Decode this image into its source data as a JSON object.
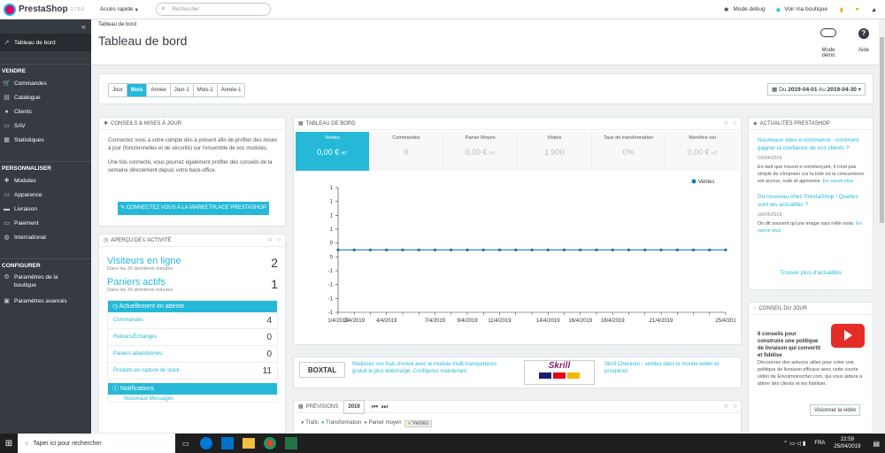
{
  "logo": {
    "name": "PrestaShop",
    "version": "1.7.5.0"
  },
  "topbar": {
    "quick_access": "Accès rapide",
    "search_placeholder": "Rechercher",
    "debug": "Mode debug",
    "view_shop": "Voir ma boutique"
  },
  "sidebar": {
    "dashboard": "Tableau de bord",
    "sections": [
      {
        "title": "VENDRE",
        "items": [
          "Commandes",
          "Catalogue",
          "Clients",
          "SAV",
          "Statistiques"
        ]
      },
      {
        "title": "PERSONNALISER",
        "items": [
          "Modules",
          "Apparence",
          "Livraison",
          "Paiement",
          "International"
        ]
      },
      {
        "title": "CONFIGURER",
        "items": [
          "Paramètres de la boutique",
          "Paramètres avancés"
        ]
      }
    ]
  },
  "header": {
    "breadcrumb": "Tableau de bord",
    "title": "Tableau de bord",
    "demo": "Mode démo",
    "help": "Aide"
  },
  "filters": {
    "periods": [
      "Jour",
      "Mois",
      "Année",
      "Jour-1",
      "Mois-1",
      "Année-1"
    ],
    "active": "Mois",
    "range_prefix": "Du",
    "from": "2019-04-01",
    "range_mid": "Au",
    "to": "2019-04-30"
  },
  "advice": {
    "title": "CONSEILS & MISES À JOUR",
    "p1": "Connectez vous à votre compte dès à présent afin de profiter des mises à jour (fonctionnelles et de sécurité) sur l'ensemble de vos modules.",
    "p2": "Une fois connecté, vous pourrez également profiter des conseils de la semaine directement depuis votre back-office.",
    "button": "CONNECTEZ VOUS A LA MARKETPLACE PRESTASHOP"
  },
  "activity": {
    "title": "APERÇU DE L'ACTIVITÉ",
    "visitors_label": "Visiteurs en ligne",
    "visitors_sub": "Dans les 30 dernières minutes",
    "visitors": "2",
    "carts_label": "Paniers actifs",
    "carts_sub": "Dans les 30 dernières minutes",
    "carts": "1",
    "pending": "Actuellement en attente",
    "rows": [
      {
        "label": "Commandes",
        "value": "4"
      },
      {
        "label": "Retours/Échanges",
        "value": "0"
      },
      {
        "label": "Paniers abandonnés",
        "value": "0"
      },
      {
        "label": "Produits en rupture de stock",
        "value": "11"
      }
    ],
    "notifications": "Notifications",
    "new_messages": "Nouveaux Messages"
  },
  "dashboard": {
    "title": "TABLEAU DE BORD",
    "kpis": [
      {
        "label": "Ventes",
        "value": "0,00 €",
        "unit": "HT"
      },
      {
        "label": "Commandes",
        "value": "0",
        "unit": ""
      },
      {
        "label": "Panier Moyen",
        "value": "0,00 €",
        "unit": "HT"
      },
      {
        "label": "Visites",
        "value": "1 900",
        "unit": ""
      },
      {
        "label": "Taux de transformation",
        "value": "0%",
        "unit": ""
      },
      {
        "label": "Bénéfice net",
        "value": "0,00 €",
        "unit": "HT"
      }
    ]
  },
  "chart_data": {
    "type": "line",
    "x": [
      "1/4/2019",
      "2/4/2019",
      "3/4/2019",
      "4/4/2019",
      "5/4/2019",
      "6/4/2019",
      "7/4/2019",
      "8/4/2019",
      "9/4/2019",
      "10/4/2019",
      "11/4/2019",
      "12/4/2019",
      "13/4/2019",
      "14/4/2019",
      "15/4/2019",
      "16/4/2019",
      "17/4/2019",
      "18/4/2019",
      "19/4/2019",
      "20/4/2019",
      "21/4/2019",
      "22/4/2019",
      "23/4/2019",
      "24/4/2019",
      "25/4/201"
    ],
    "tick_labels": [
      "1/4/2019",
      "2/4/2019",
      "4/4/2019",
      "7/4/2019",
      "9/4/2019",
      "11/4/2019",
      "14/4/2019",
      "16/4/2019",
      "18/4/2019",
      "21/4/2019",
      "25/4/201"
    ],
    "y_ticks": [
      "1",
      "1",
      "1",
      "1",
      "0",
      "0",
      "-1",
      "-1",
      "-1",
      "-1"
    ],
    "series": [
      {
        "name": "Ventes",
        "values": [
          0,
          0,
          0,
          0,
          0,
          0,
          0,
          0,
          0,
          0,
          0,
          0,
          0,
          0,
          0,
          0,
          0,
          0,
          0,
          0,
          0,
          0,
          0,
          0,
          0
        ]
      }
    ],
    "color": "#1777b6",
    "legend": "top-right"
  },
  "carriers": {
    "boxtal_logo": "BOXTAL",
    "boxtal_text": "Réduisez vos frais d'envoi avec le module multi-transporteurs gratuit le plus téléchargé. Configurez maintenant",
    "skrill_logo": "Skrill",
    "skrill_text": "Skrill Checkout - vendez dans le monde entier et prospérez"
  },
  "forecast": {
    "title": "PRÉVISIONS",
    "year": "2019",
    "legend": [
      "Trafic",
      "Transformation",
      "Panier moyen",
      "Ventes"
    ]
  },
  "news": {
    "title": "ACTUALITÉS PRESTASHOP",
    "items": [
      {
        "title": "Nouveaux sites e-commerce : comment gagner la confiance de vos clients ?",
        "date": "19/04/2019",
        "text": "En tant que nouvel e-commerçant, il n'est pas simple de s'imposer sur la toile où la concurrence est accrue, rude et agressive.",
        "more": "En savoir plus"
      },
      {
        "title": "Du nouveau chez PrestaShop ! Quelles sont les actualités ?",
        "date": "18/04/2019",
        "text": "On dit souvent qu'une image vaut mille mots.",
        "more": "En savoir plus"
      }
    ],
    "find_more": "Trouver plus d'actualités"
  },
  "tip": {
    "title": "CONSEIL DU JOUR",
    "heading": "6 conseils pour construire une politique de livraison qui convertit et fidélise",
    "text": "Découvrez des astuces utiles pour créer une politique de livraison efficace avec cette courte vidéo de Envoimoinscher.com, qui vous aidera à attirer des clients et les fidéliser.",
    "button": "Visionner la vidéo"
  },
  "taskbar": {
    "search": "Taper ici pour rechercher",
    "lang": "FRA",
    "time": "22:59",
    "date": "25/04/2019"
  },
  "colors": {
    "accent": "#25b9d7",
    "sidebar": "#363a41",
    "brand": "#df0067"
  }
}
